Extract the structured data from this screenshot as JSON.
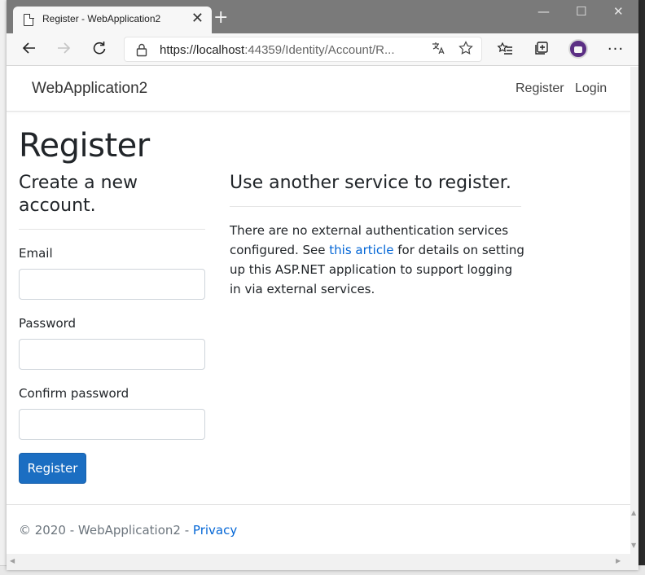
{
  "browser": {
    "tab_title": "Register - WebApplication2",
    "tab_close": "✕",
    "new_tab": "+",
    "minimize": "—",
    "maximize": "☐",
    "close": "✕",
    "url_host": "https://localhost",
    "url_rest": ":44359/Identity/Account/R...",
    "icons": [
      "back-icon",
      "forward-icon",
      "refresh-icon",
      "lock-icon",
      "translate-icon",
      "favorite-star-icon",
      "favorites-list-icon",
      "collections-icon",
      "profile-avatar",
      "more-icon"
    ]
  },
  "navbar": {
    "brand": "WebApplication2",
    "register": "Register",
    "login": "Login"
  },
  "main": {
    "heading": "Register",
    "left_heading": "Create a new account.",
    "email_label": "Email",
    "password_label": "Password",
    "confirm_label": "Confirm password",
    "submit_label": "Register",
    "right_heading": "Use another service to register.",
    "para_before": "There are no external authentication services configured. See ",
    "para_link": "this article",
    "para_after": " for details on setting up this ASP.NET application to support logging in via external services."
  },
  "footer": {
    "text": "© 2020 - WebApplication2 - ",
    "privacy": "Privacy"
  },
  "colors": {
    "primary": "#1b6ec2",
    "link": "#0366d6",
    "tabbar": "#7a7a7a"
  }
}
